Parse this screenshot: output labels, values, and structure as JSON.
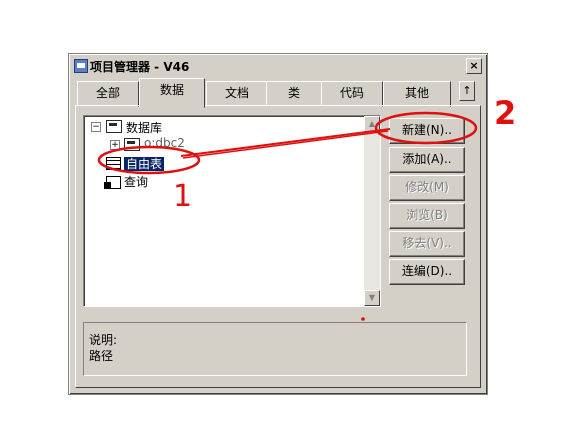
{
  "window": {
    "title": "项目管理器 - V46",
    "close_label": "×"
  },
  "tabs": [
    {
      "label": "全部",
      "active": false
    },
    {
      "label": "数据",
      "active": true
    },
    {
      "label": "文档",
      "active": false
    },
    {
      "label": "类",
      "active": false
    },
    {
      "label": "代码",
      "active": false
    },
    {
      "label": "其他",
      "active": false
    }
  ],
  "tab_scroll_label": "↑",
  "tree": {
    "root_expander": "−",
    "root_label": "数据库",
    "child_expander": "+",
    "child_label": "o:dbc2",
    "free_table_label": "自由表",
    "query_label": "查询"
  },
  "scroll": {
    "up": "▲",
    "down": "▼"
  },
  "buttons": [
    {
      "label": "新建(N)..",
      "enabled": true
    },
    {
      "label": "添加(A)..",
      "enabled": true
    },
    {
      "label": "修改(M)",
      "enabled": false
    },
    {
      "label": "浏览(B)",
      "enabled": false
    },
    {
      "label": "移去(V)..",
      "enabled": false
    },
    {
      "label": "连编(D)..",
      "enabled": true
    }
  ],
  "description": {
    "line1": "说明:",
    "line2": "路径"
  },
  "annotations": {
    "label1": "1",
    "label2": "2",
    "color": "#e01010"
  }
}
